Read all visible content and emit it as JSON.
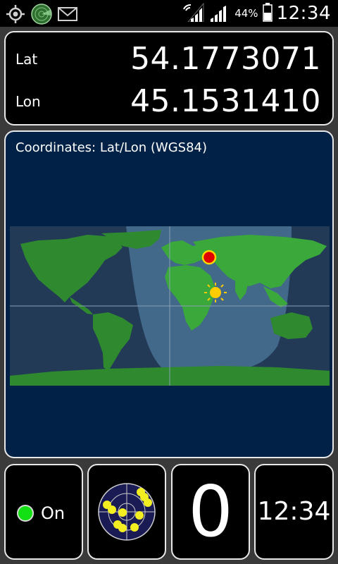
{
  "status_bar": {
    "battery_percent": "44%",
    "time": "12:34",
    "left_icons": [
      "gps-target-icon",
      "radar-app-icon",
      "envelope-icon"
    ],
    "right_icons": [
      "wifi-signal-icon",
      "cell-signal-icon",
      "battery-icon"
    ]
  },
  "coordinates": {
    "lat_label": "Lat",
    "lat_value": "54.1773071",
    "lon_label": "Lon",
    "lon_value": "45.1531410"
  },
  "map": {
    "caption": "Coordinates: Lat/Lon (WGS84)",
    "position_marker_color": "#e00000",
    "sun_marker_color": "#ffcc00"
  },
  "bottom": {
    "gps_label": "On",
    "gps_led_color": "#12e012",
    "satellite_count": "0",
    "clock": "12:34"
  },
  "colors": {
    "map_background": "#012246",
    "land": "#3aa83a",
    "land_dark": "#2a6f2a",
    "night_overlay": "#1f3550"
  }
}
